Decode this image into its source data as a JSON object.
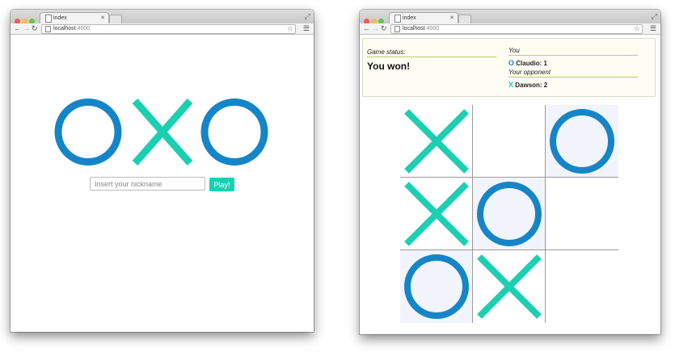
{
  "left_window": {
    "tab_title": "index",
    "url_host": "localhost",
    "url_port": ":4000",
    "logo_letters": [
      "O",
      "X",
      "O"
    ],
    "nickname_input": {
      "value": "",
      "placeholder": "Insert your nickname"
    },
    "play_label": "Play!"
  },
  "right_window": {
    "tab_title": "index",
    "url_host": "localhost",
    "url_port": ":4000",
    "status": {
      "label": "Game status:",
      "value": "You won!",
      "you_label": "You",
      "you": {
        "mark": "O",
        "name_score": "Claudio: 1"
      },
      "opponent_label": "Your opponent",
      "opponent": {
        "mark": "X",
        "name_score": "Dawson: 2"
      }
    },
    "board": [
      [
        "X",
        "",
        "O"
      ],
      [
        "X",
        "O",
        ""
      ],
      [
        "O",
        "X",
        ""
      ]
    ]
  },
  "colors": {
    "o_blue": "#1585c8",
    "x_teal": "#1ccfb3",
    "play_button": "#1ccfb3",
    "status_underline": "#b9cf6e"
  },
  "icons": [
    "close-icon",
    "star-icon",
    "menu-icon",
    "back-arrow-icon",
    "forward-arrow-icon",
    "reload-icon",
    "page-icon",
    "fullscreen-icon"
  ]
}
